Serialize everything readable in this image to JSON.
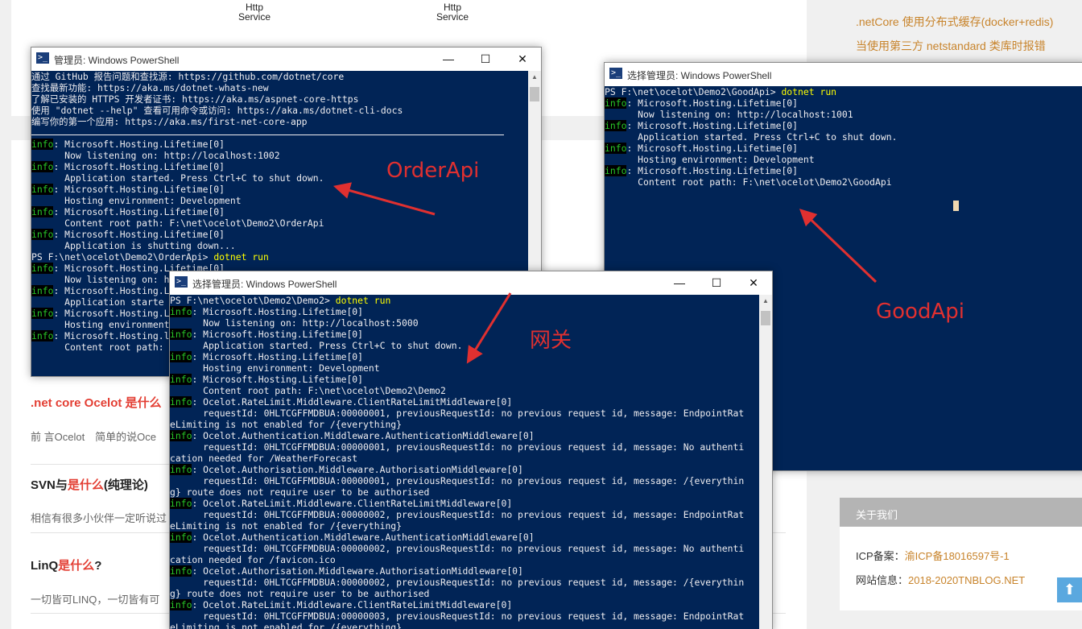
{
  "blog": {
    "diagram_labels": [
      {
        "line1": "Http",
        "line2": "Service"
      },
      {
        "line1": "Http",
        "line2": "Service"
      }
    ],
    "articles": [
      {
        "title_hl": ".net core Ocelot 是什么",
        "title_rest": "",
        "excerpt": "前 言Ocelot　简单的说Oce"
      },
      {
        "title_plain": "SVN与",
        "title_hl": "是什么",
        "title_rest": "(纯理论)",
        "excerpt": "相信有很多小伙伴一定听说过"
      },
      {
        "title_plain": "LinQ",
        "title_hl": "是什么",
        "title_rest": "?",
        "excerpt": "一切皆可LINQ，一切皆有可"
      }
    ]
  },
  "sidebar": {
    "links": [
      ".netCore 使用分布式缓存(docker+redis)",
      "当使用第三方 netstandard 类库时报错"
    ],
    "about": {
      "header": "关于我们",
      "icp_label": "ICP备案：",
      "icp_value": "渝ICP备18016597号-1",
      "site_label": "网站信息：",
      "site_value": "2018-2020TNBLOG.NET"
    },
    "back_to_top": "⬆"
  },
  "windows": {
    "order": {
      "title": "管理员: Windows PowerShell",
      "lines": [
        {
          "t": "通过 GitHub 报告问题和查找源: https://github.com/dotnet/core"
        },
        {
          "t": "查找最新功能: https://aka.ms/dotnet-whats-new"
        },
        {
          "t": "了解已安装的 HTTPS 开发者证书: https://aka.ms/aspnet-core-https"
        },
        {
          "t": "使用 \"dotnet --help\" 查看可用命令或访问: https://aka.ms/dotnet-cli-docs"
        },
        {
          "t": "编写你的第一个应用: https://aka.ms/first-net-core-app"
        },
        {
          "sep": true
        },
        {
          "i": "info",
          "t": ": Microsoft.Hosting.Lifetime[0]"
        },
        {
          "t": "      Now listening on: http://localhost:1002"
        },
        {
          "i": "info",
          "t": ": Microsoft.Hosting.Lifetime[0]"
        },
        {
          "t": "      Application started. Press Ctrl+C to shut down."
        },
        {
          "i": "info",
          "t": ": Microsoft.Hosting.Lifetime[0]"
        },
        {
          "t": "      Hosting environment: Development"
        },
        {
          "i": "info",
          "t": ": Microsoft.Hosting.Lifetime[0]"
        },
        {
          "t": "      Content root path: F:\\net\\ocelot\\Demo2\\OrderApi"
        },
        {
          "i": "info",
          "t": ": Microsoft.Hosting.Lifetime[0]"
        },
        {
          "t": "      Application is shutting down..."
        },
        {
          "t": "PS F:\\net\\ocelot\\Demo2\\OrderApi> ",
          "c": "dotnet run"
        },
        {
          "i": "info",
          "t": ": Microsoft.Hosting.Lifetime[0]"
        },
        {
          "t": "      Now listening on: h"
        },
        {
          "i": "info",
          "t": ": Microsoft.Hosting.Lifetime[0]"
        },
        {
          "t": "      Application starte"
        },
        {
          "i": "info",
          "t": ": Microsoft.Hosting.Lifetime[0]"
        },
        {
          "t": "      Hosting environment"
        },
        {
          "i": "info",
          "t": ": Microsoft.Hosting.l"
        },
        {
          "t": "      Content root path:"
        }
      ]
    },
    "good": {
      "title": "选择管理员: Windows PowerShell",
      "lines": [
        {
          "t": "PS F:\\net\\ocelot\\Demo2\\GoodApi> ",
          "c": "dotnet run"
        },
        {
          "i": "info",
          "t": ": Microsoft.Hosting.Lifetime[0]"
        },
        {
          "t": "      Now listening on: http://localhost:1001"
        },
        {
          "i": "info",
          "t": ": Microsoft.Hosting.Lifetime[0]"
        },
        {
          "t": "      Application started. Press Ctrl+C to shut down."
        },
        {
          "i": "info",
          "t": ": Microsoft.Hosting.Lifetime[0]"
        },
        {
          "t": "      Hosting environment: Development"
        },
        {
          "i": "info",
          "t": ": Microsoft.Hosting.Lifetime[0]"
        },
        {
          "t": "      Content root path: F:\\net\\ocelot\\Demo2\\GoodApi"
        }
      ]
    },
    "gateway": {
      "title": "选择管理员: Windows PowerShell",
      "lines": [
        {
          "t": "PS F:\\net\\ocelot\\Demo2\\Demo2> ",
          "c": "dotnet run"
        },
        {
          "i": "info",
          "t": ": Microsoft.Hosting.Lifetime[0]"
        },
        {
          "t": "      Now listening on: http://localhost:5000"
        },
        {
          "i": "info",
          "t": ": Microsoft.Hosting.Lifetime[0]"
        },
        {
          "t": "      Application started. Press Ctrl+C to shut down."
        },
        {
          "i": "info",
          "t": ": Microsoft.Hosting.Lifetime[0]"
        },
        {
          "t": "      Hosting environment: Development"
        },
        {
          "i": "info",
          "t": ": Microsoft.Hosting.Lifetime[0]"
        },
        {
          "t": "      Content root path: F:\\net\\ocelot\\Demo2\\Demo2"
        },
        {
          "i": "info",
          "t": ": Ocelot.RateLimit.Middleware.ClientRateLimitMiddleware[0]"
        },
        {
          "t": "      requestId: 0HLTCGFFMDBUA:00000001, previousRequestId: no previous request id, message: EndpointRat"
        },
        {
          "t": "eLimiting is not enabled for /{everything}"
        },
        {
          "i": "info",
          "t": ": Ocelot.Authentication.Middleware.AuthenticationMiddleware[0]"
        },
        {
          "t": "      requestId: 0HLTCGFFMDBUA:00000001, previousRequestId: no previous request id, message: No authenti"
        },
        {
          "t": "cation needed for /WeatherForecast"
        },
        {
          "i": "info",
          "t": ": Ocelot.Authorisation.Middleware.AuthorisationMiddleware[0]"
        },
        {
          "t": "      requestId: 0HLTCGFFMDBUA:00000001, previousRequestId: no previous request id, message: /{everythin"
        },
        {
          "t": "g} route does not require user to be authorised"
        },
        {
          "i": "info",
          "t": ": Ocelot.RateLimit.Middleware.ClientRateLimitMiddleware[0]"
        },
        {
          "t": "      requestId: 0HLTCGFFMDBUA:00000002, previousRequestId: no previous request id, message: EndpointRat"
        },
        {
          "t": "eLimiting is not enabled for /{everything}"
        },
        {
          "i": "info",
          "t": ": Ocelot.Authentication.Middleware.AuthenticationMiddleware[0]"
        },
        {
          "t": "      requestId: 0HLTCGFFMDBUA:00000002, previousRequestId: no previous request id, message: No authenti"
        },
        {
          "t": "cation needed for /favicon.ico"
        },
        {
          "i": "info",
          "t": ": Ocelot.Authorisation.Middleware.AuthorisationMiddleware[0]"
        },
        {
          "t": "      requestId: 0HLTCGFFMDBUA:00000002, previousRequestId: no previous request id, message: /{everythin"
        },
        {
          "t": "g} route does not require user to be authorised"
        },
        {
          "i": "info",
          "t": ": Ocelot.RateLimit.Middleware.ClientRateLimitMiddleware[0]"
        },
        {
          "t": "      requestId: 0HLTCGFFMDBUA:00000003, previousRequestId: no previous request id, message: EndpointRat"
        },
        {
          "t": "eLimiting is not enabled for /{everything}"
        }
      ]
    }
  },
  "window_controls": {
    "minimize": "—",
    "maximize": "☐",
    "close": "✕"
  },
  "annotations": {
    "order": "OrderApi",
    "good": "GoodApi",
    "gateway": "网关",
    "color": "#e03030"
  },
  "theme": {
    "console_bg": "#012456",
    "info_fg": "#28c828",
    "command_fg": "#ffff00",
    "link_orange": "#c8842c",
    "highlight_red": "#e33e33"
  }
}
